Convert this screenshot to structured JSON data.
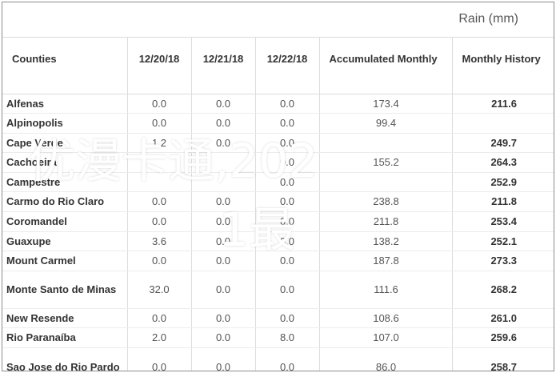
{
  "header": {
    "title": "Rain (mm)"
  },
  "columns": [
    "Counties",
    "12/20/18",
    "12/21/18",
    "12/22/18",
    "Accumulated Monthly",
    "Monthly History"
  ],
  "rows": [
    {
      "county": "Alfenas",
      "d1": "0.0",
      "d2": "0.0",
      "d3": "0.0",
      "accum": "173.4",
      "hist": "211.6"
    },
    {
      "county": "Alpinopolis",
      "d1": "0.0",
      "d2": "0.0",
      "d3": "0.0",
      "accum": "99.4",
      "hist": ""
    },
    {
      "county": "Cape Verde",
      "d1": "1.2",
      "d2": "0.0",
      "d3": "0.0",
      "accum": "",
      "hist": "249.7"
    },
    {
      "county": "Cachoeira",
      "d1": "",
      "d2": "",
      "d3": "0.0",
      "accum": "155.2",
      "hist": "264.3"
    },
    {
      "county": "Campestre",
      "d1": "",
      "d2": "",
      "d3": "0.0",
      "accum": "",
      "hist": "252.9"
    },
    {
      "county": "Carmo do Rio Claro",
      "d1": "0.0",
      "d2": "0.0",
      "d3": "0.0",
      "accum": "238.8",
      "hist": "211.8"
    },
    {
      "county": "Coromandel",
      "d1": "0.0",
      "d2": "0.0",
      "d3": "0.0",
      "accum": "211.8",
      "hist": "253.4"
    },
    {
      "county": "Guaxupe",
      "d1": "3.6",
      "d2": "0.0",
      "d3": "0.0",
      "accum": "138.2",
      "hist": "252.1"
    },
    {
      "county": "Mount Carmel",
      "d1": "0.0",
      "d2": "0.0",
      "d3": "0.0",
      "accum": "187.8",
      "hist": "273.3"
    },
    {
      "county": "Monte Santo de Minas",
      "d1": "32.0",
      "d2": "0.0",
      "d3": "0.0",
      "accum": "111.6",
      "hist": "268.2"
    },
    {
      "county": "New Resende",
      "d1": "0.0",
      "d2": "0.0",
      "d3": "0.0",
      "accum": "108.6",
      "hist": "261.0"
    },
    {
      "county": "Rio Paranaíba",
      "d1": "2.0",
      "d2": "0.0",
      "d3": "8.0",
      "accum": "107.0",
      "hist": "259.6"
    },
    {
      "county": "Sao Jose do Rio Pardo",
      "d1": "0.0",
      "d2": "0.0",
      "d3": "0.0",
      "accum": "86.0",
      "hist": "258.7"
    }
  ],
  "watermark": {
    "line1": "优漫卡通,202",
    "line2": "1最"
  }
}
